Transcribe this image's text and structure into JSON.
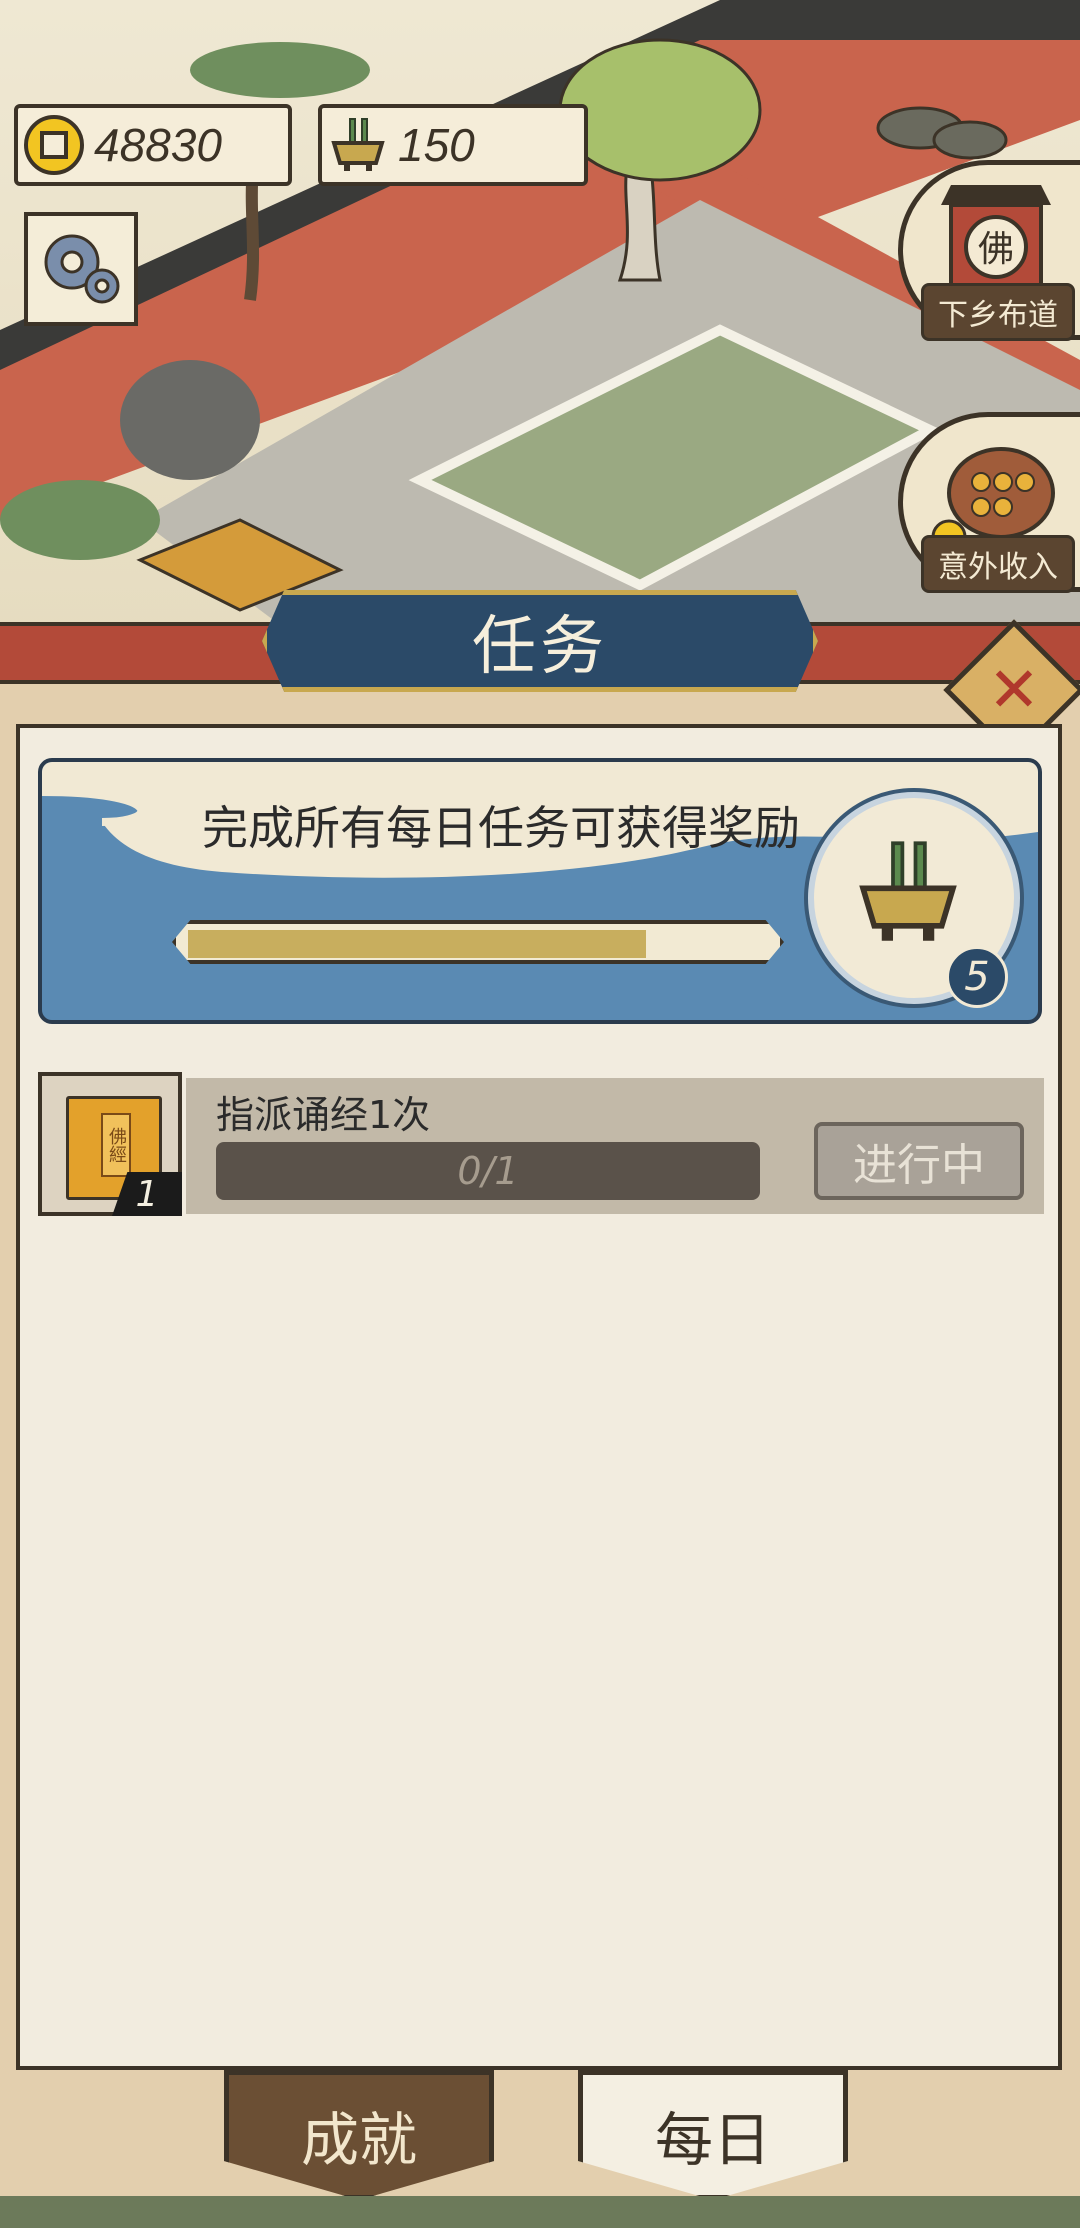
{
  "hud": {
    "coins": "48830",
    "incense": "150",
    "side_buttons": [
      {
        "label": "下乡布道",
        "icon": "buddha-shrine-icon"
      },
      {
        "label": "意外收入",
        "icon": "abacus-icon"
      }
    ]
  },
  "panel": {
    "title": "任务",
    "reward": {
      "text": "完成所有每日任务可获得奖励",
      "progress": 0.79,
      "reward_icon": "incense-burner-icon",
      "reward_count": "5"
    },
    "tasks": [
      {
        "title": "指派诵经1次",
        "icon": "buddhist-sutra-book-icon",
        "icon_label": "佛經",
        "quantity": "1",
        "progress_text": "0/1",
        "status": "进行中"
      }
    ]
  },
  "tabs": [
    {
      "label": "成就",
      "active": false
    },
    {
      "label": "每日",
      "active": true
    }
  ],
  "colors": {
    "banner_red": "#b34a39",
    "title_blue": "#2b4a68",
    "progress_gold": "#c8ae5e",
    "panel_bg": "#f2ecdf"
  }
}
